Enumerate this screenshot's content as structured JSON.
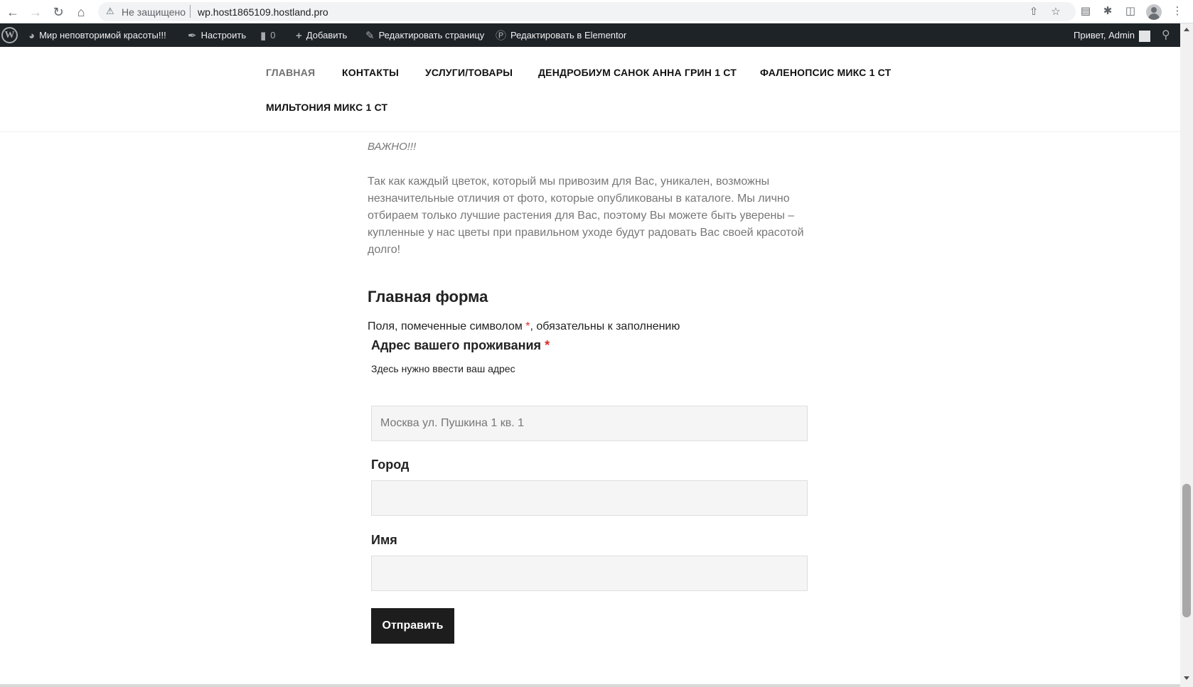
{
  "browser": {
    "insecure_label": "Не защищено",
    "url": "wp.host1865109.hostland.pro"
  },
  "admin_bar": {
    "site_name": "Мир неповторимой красоты!!!",
    "customize": "Настроить",
    "comments_count": "0",
    "add_new": "Добавить",
    "edit_page": "Редактировать страницу",
    "edit_elementor": "Редактировать в Elementor",
    "greeting": "Привет, Admin"
  },
  "nav": {
    "items": [
      {
        "label": "ГЛАВНАЯ",
        "active": true
      },
      {
        "label": "КОНТАКТЫ",
        "active": false
      },
      {
        "label": "УСЛУГИ/ТОВАРЫ",
        "active": false
      },
      {
        "label": "ДЕНДРОБИУМ САНОК АННА ГРИН 1 СТ",
        "active": false
      },
      {
        "label": "ФАЛЕНОПСИС МИКС 1 СТ",
        "active": false
      },
      {
        "label": "МИЛЬТОНИЯ МИКС 1 СТ",
        "active": false
      }
    ]
  },
  "content": {
    "important": "ВАЖНО!!!",
    "paragraph": "Так как каждый цветок, который мы привозим для Вас, уникален, возможны незначительные отличия от фото, которые опубликованы в каталоге. Мы лично отбираем только лучшие растения для Вас, поэтому Вы можете быть уверены – купленные у нас цветы при правильном уходе будут радовать Вас своей красотой долго!"
  },
  "form": {
    "title": "Главная форма",
    "required_note_prefix": "Поля, помеченные символом ",
    "required_mark": "*",
    "required_note_suffix": ", обязательны к заполнению",
    "address": {
      "label": "Адрес вашего проживания",
      "description": "Здесь нужно ввести ваш адрес",
      "placeholder": "Москва ул. Пушкина 1 кв. 1"
    },
    "city": {
      "label": "Город"
    },
    "name": {
      "label": "Имя"
    },
    "submit_label": "Отправить"
  }
}
